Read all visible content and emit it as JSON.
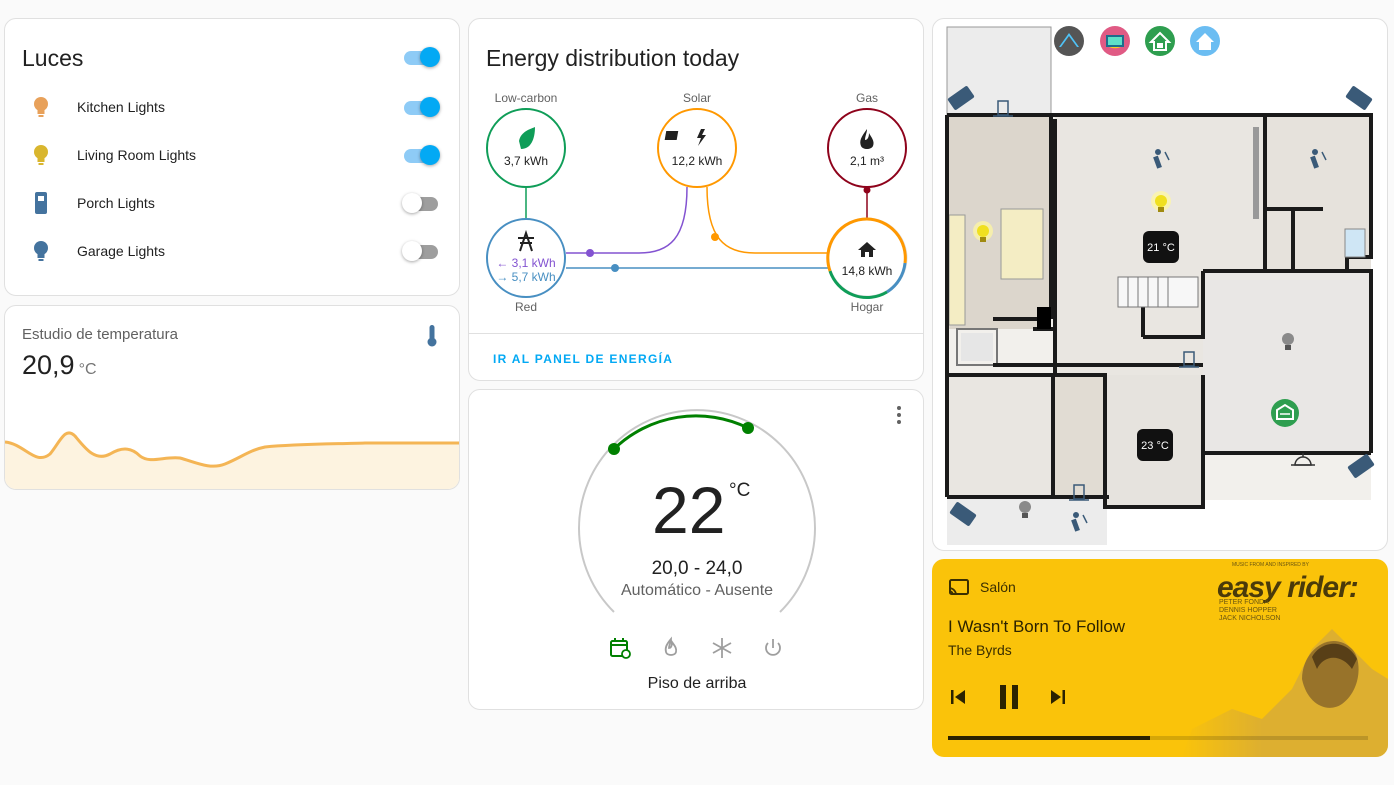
{
  "lights": {
    "title": "Luces",
    "master_on": true,
    "items": [
      {
        "name": "Kitchen Lights",
        "on": true,
        "icon": "bulb-icon",
        "color": "#e8a15a"
      },
      {
        "name": "Living Room Lights",
        "on": true,
        "icon": "bulb-icon",
        "color": "#d9b62e"
      },
      {
        "name": "Porch Lights",
        "on": false,
        "icon": "lamp-icon",
        "color": "#44739e"
      },
      {
        "name": "Garage Lights",
        "on": false,
        "icon": "bulb-icon",
        "color": "#44739e"
      }
    ]
  },
  "temperature": {
    "title": "Estudio de temperatura",
    "value": "20,9",
    "unit": "°C"
  },
  "energy": {
    "title": "Energy distribution today",
    "nodes": {
      "low_carbon": {
        "label": "Low-carbon",
        "value": "3,7 kWh"
      },
      "solar": {
        "label": "Solar",
        "value": "12,2 kWh"
      },
      "gas": {
        "label": "Gas",
        "value": "2,1 m³"
      },
      "grid": {
        "label": "Red",
        "in_value": "← 3,1 kWh",
        "out_value": "→ 5,7 kWh"
      },
      "home": {
        "label": "Hogar",
        "value": "14,8 kWh"
      }
    },
    "link": "IR AL PANEL DE ENERGÍA",
    "colors": {
      "low_carbon": "#0f9d58",
      "solar": "#ff9800",
      "gas": "#8e021b",
      "grid": "#488fc2",
      "grid_return": "#8353d1"
    }
  },
  "thermostat": {
    "current": "22",
    "unit": "°C",
    "range": "20,0 - 24,0",
    "mode": "Automático - Ausente",
    "name": "Piso de arriba",
    "modes": [
      "calendar-sync-icon",
      "flame-icon",
      "snowflake-icon",
      "power-icon"
    ],
    "active_color": "#008000"
  },
  "floorplan": {
    "thermostats": [
      "21 °C",
      "23 °C"
    ]
  },
  "media": {
    "source": "Salón",
    "title": "I Wasn't Born To Follow",
    "artist": "The Byrds",
    "progress": 0.48,
    "album_title": "easy rider:",
    "album_names": [
      "PETER FONDA",
      "DENNIS HOPPER",
      "JACK NICHOLSON"
    ],
    "album_top": "MUSIC FROM AND INSPIRED BY"
  }
}
